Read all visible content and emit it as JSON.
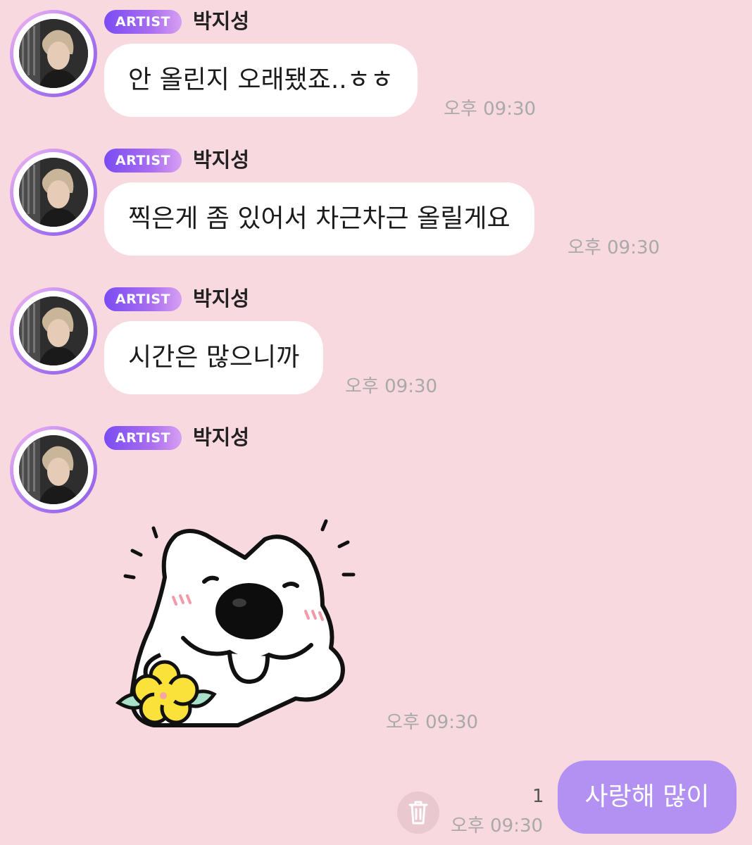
{
  "messages": [
    {
      "badge": "ARTIST",
      "sender": "박지성",
      "text": "안 올린지 오래됐죠..ㅎㅎ",
      "time": "오후 09:30"
    },
    {
      "badge": "ARTIST",
      "sender": "박지성",
      "text": "찍은게 좀 있어서 차근차근 올릴게요",
      "time": "오후 09:30"
    },
    {
      "badge": "ARTIST",
      "sender": "박지성",
      "text": "시간은 많으니까",
      "time": "오후 09:30"
    },
    {
      "badge": "ARTIST",
      "sender": "박지성",
      "sticker": "puppy-with-flower-sticker",
      "time": "오후 09:30"
    }
  ],
  "my_message": {
    "text": "사랑해 많이",
    "time": "오후 09:30",
    "unread_count": "1",
    "delete_icon": "trash-icon"
  },
  "colors": {
    "background": "#f9d9e0",
    "artist_bubble": "#ffffff",
    "my_bubble": "#b391f2",
    "badge_gradient_start": "#7a4cf2",
    "badge_gradient_end": "#d79ff2",
    "timestamp": "#a9a9a9"
  }
}
